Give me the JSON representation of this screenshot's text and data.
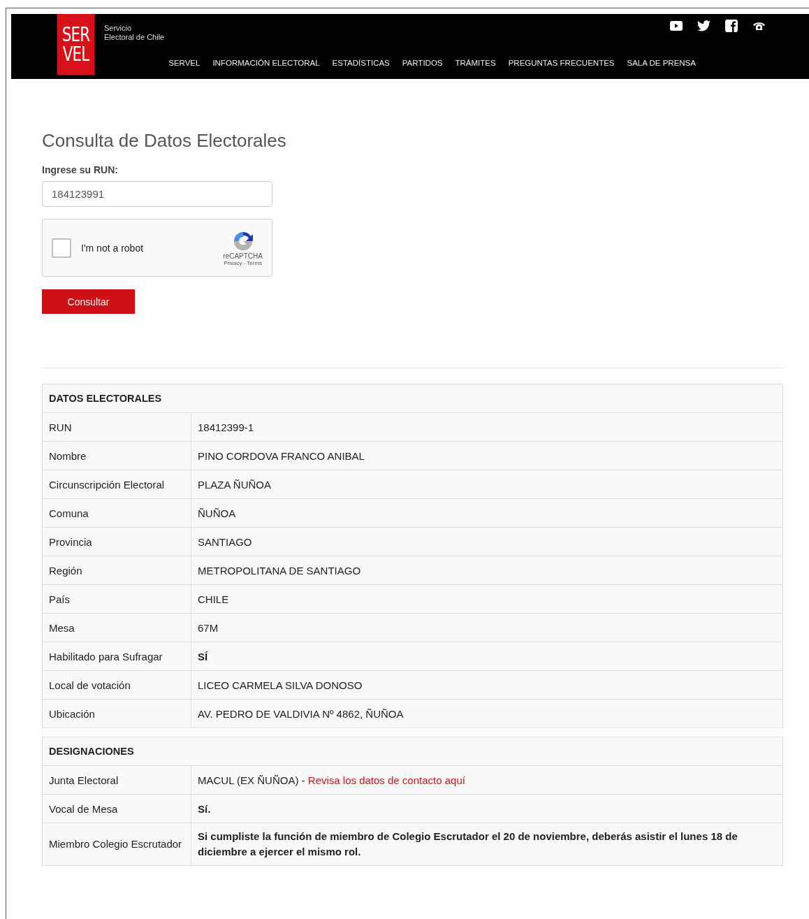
{
  "header": {
    "logo_top": "SER",
    "logo_bottom": "VEL",
    "tagline_1": "Servicio",
    "tagline_2": "Electoral de Chile",
    "nav": [
      "SERVEL",
      "INFORMACIÓN ELECTORAL",
      "ESTADÍSTICAS",
      "PARTIDOS",
      "TRÁMITES",
      "PREGUNTAS FRECUENTES",
      "SALA DE PRENSA"
    ],
    "social": [
      {
        "kind": "youtube"
      },
      {
        "kind": "twitter"
      },
      {
        "kind": "facebook"
      },
      {
        "kind": "phone"
      }
    ]
  },
  "form": {
    "title": "Consulta de Datos Electorales",
    "label": "Ingrese su RUN:",
    "value": "184123991",
    "captcha": {
      "label": "I'm not a robot",
      "checked": false,
      "brand": "reCAPTCHA",
      "links": "Privacy - Terms"
    },
    "button": "Consultar"
  },
  "tables": [
    {
      "title": "DATOS ELECTORALES",
      "rows": [
        {
          "label": "RUN",
          "value": "18412399-1",
          "bold": false
        },
        {
          "label": "Nombre",
          "value": "PINO CORDOVA FRANCO ANIBAL",
          "bold": false
        },
        {
          "label": "Circunscripción Electoral",
          "value": "PLAZA ÑUÑOA",
          "bold": false
        },
        {
          "label": "Comuna",
          "value": "ÑUÑOA",
          "bold": false
        },
        {
          "label": "Provincia",
          "value": "SANTIAGO",
          "bold": false
        },
        {
          "label": "Región",
          "value": "METROPOLITANA DE SANTIAGO",
          "bold": false
        },
        {
          "label": "País",
          "value": "CHILE",
          "bold": false
        },
        {
          "label": "Mesa",
          "value": "67M",
          "bold": false
        },
        {
          "label": "Habilitado para Sufragar",
          "value": "SÍ",
          "bold": true
        },
        {
          "label": "Local de votación",
          "value": "LICEO CARMELA SILVA DONOSO",
          "bold": false
        },
        {
          "label": "Ubicación",
          "value": "AV. PEDRO DE VALDIVIA Nº 4862, ÑUÑOA",
          "bold": false
        }
      ]
    },
    {
      "title": "DESIGNACIONES",
      "rows": [
        {
          "label": "Junta Electoral",
          "value": "MACUL (EX ÑUÑOA) - ",
          "link": "Revisa los datos de contacto aquí",
          "bold": false
        },
        {
          "label": "Vocal de Mesa",
          "value": "Sí.",
          "bold": true
        },
        {
          "label": "Miembro Colegio Escrutador",
          "value": "Si cumpliste la función de miembro de Colegio Escrutador el 20 de noviembre, deberás asistir el lunes 18 de diciembre a ejercer el mismo rol.",
          "bold": true
        }
      ]
    }
  ]
}
